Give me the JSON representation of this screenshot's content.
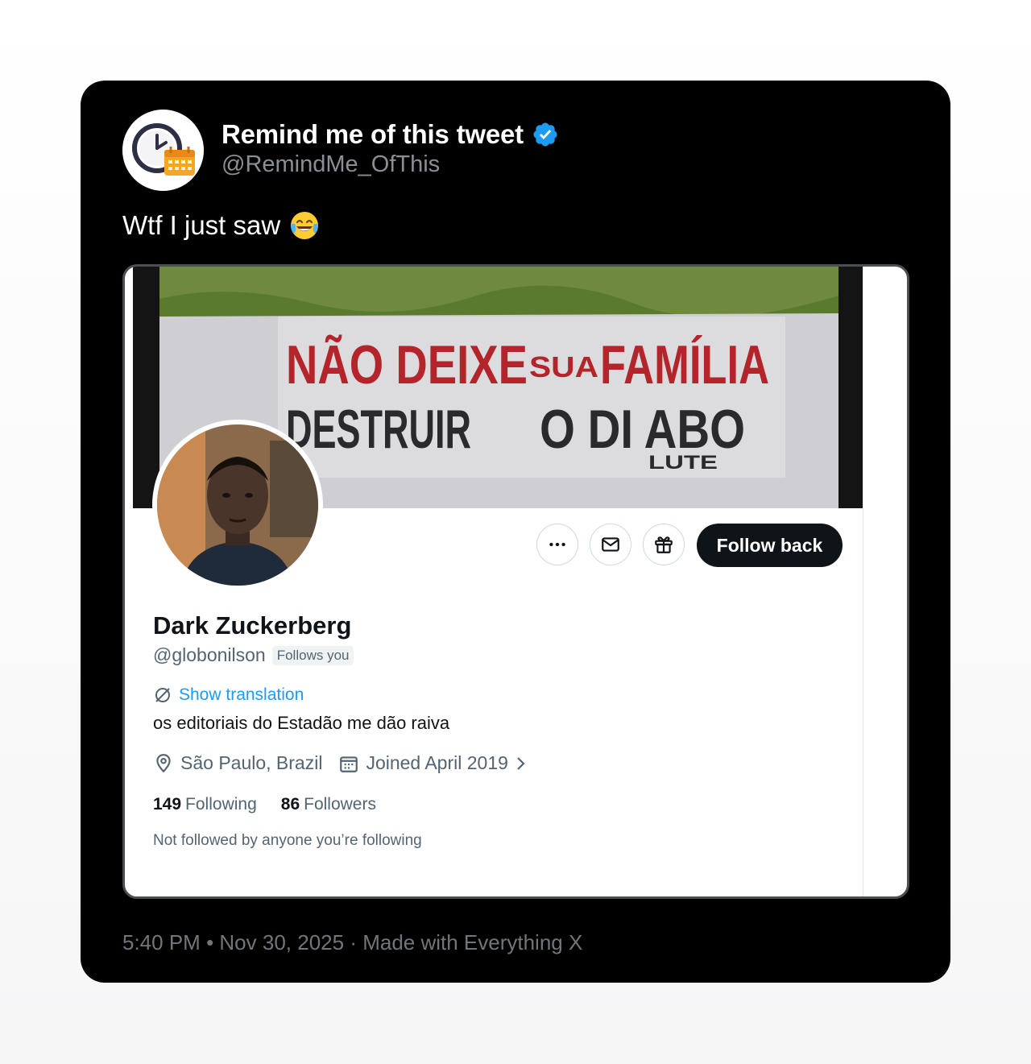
{
  "tweet": {
    "display_name": "Remind me of this tweet",
    "handle": "@RemindMe_OfThis",
    "verified": true,
    "avatar_icon": "clock-calendar-icon",
    "text": "Wtf I just saw",
    "emoji": "face-with-tears-of-joy",
    "footer_time": "5:40 PM",
    "footer_separator": "•",
    "footer_date": "Nov 30, 2025",
    "footer_made_with": "· Made with Everything X",
    "colors": {
      "card_bg": "#000000",
      "verified_blue": "#1d9bf0",
      "muted": "#71767b"
    }
  },
  "embedded_profile": {
    "banner_line1": "NÃO DEIXE",
    "banner_line1b": "SUA",
    "banner_line1c": "FAMÍLIA",
    "banner_line2a": "DESTRUIR",
    "banner_line2b": "O DI ABO",
    "banner_line3": "LUTE",
    "name": "Dark Zuckerberg",
    "handle": "@globonilson",
    "follows_you": "Follows you",
    "show_translation": "Show translation",
    "bio": "os editoriais do Estadão me dão raiva",
    "location": "São Paulo, Brazil",
    "joined": "Joined April 2019",
    "following_count": "149",
    "following_label": "Following",
    "followers_count": "86",
    "followers_label": "Followers",
    "not_followed": "Not followed by anyone you’re following",
    "follow_back": "Follow back",
    "action_icons": [
      "more-icon",
      "message-icon",
      "gift-icon"
    ]
  }
}
